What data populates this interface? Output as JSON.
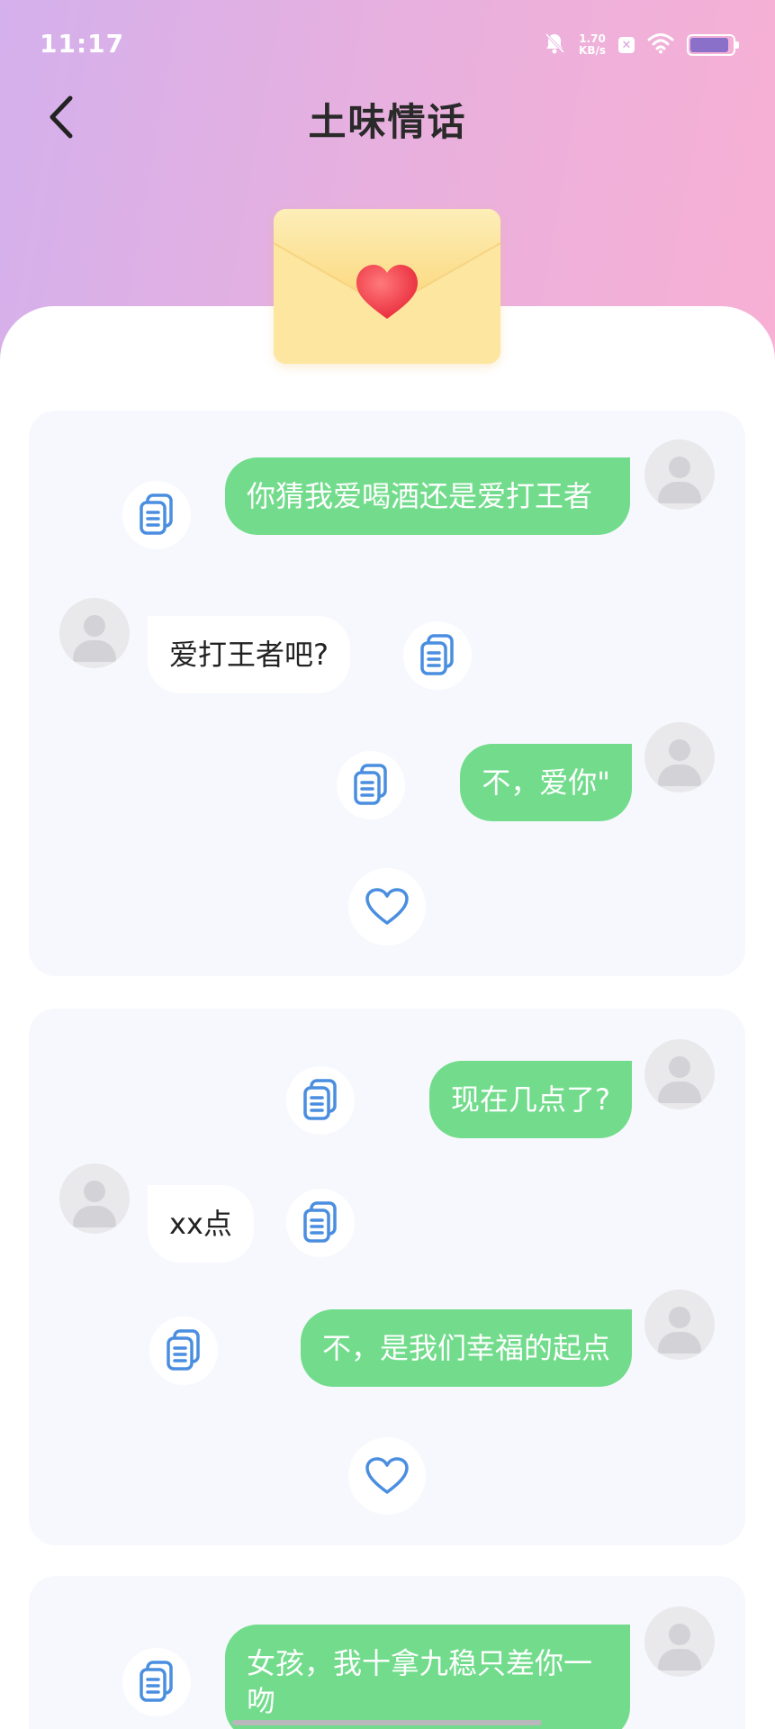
{
  "status_bar": {
    "time": "11:17",
    "net_speed_value": "1.70",
    "net_speed_unit": "KB/s",
    "battery_level": 0.92
  },
  "nav": {
    "title": "土味情话",
    "back_icon": "chevron-left-icon"
  },
  "colors": {
    "accent_green": "#72dc8c",
    "icon_blue": "#4a8ee0",
    "card_bg": "#f7f8fd"
  },
  "cards": [
    {
      "messages": [
        {
          "side": "me",
          "text": "你猜我爱喝酒还是爱打王者"
        },
        {
          "side": "other",
          "text": "爱打王者吧?"
        },
        {
          "side": "me",
          "text": "不，爱你\""
        }
      ]
    },
    {
      "messages": [
        {
          "side": "me",
          "text": "现在几点了?"
        },
        {
          "side": "other",
          "text": "xx点"
        },
        {
          "side": "me",
          "text": "不，是我们幸福的起点"
        }
      ]
    },
    {
      "messages": [
        {
          "side": "me",
          "text": "女孩，我十拿九稳只差你一吻"
        }
      ]
    }
  ]
}
